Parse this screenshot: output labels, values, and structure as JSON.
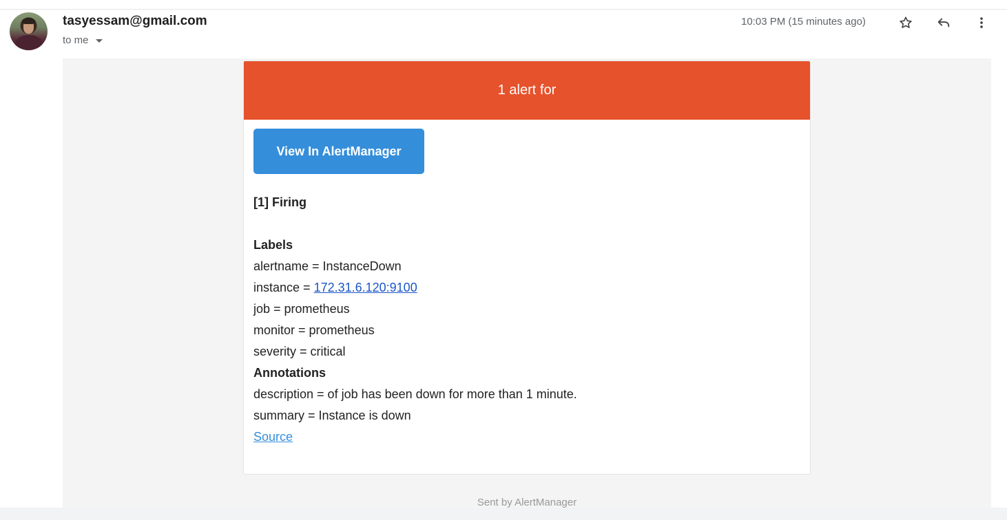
{
  "email": {
    "sender": "tasyessam@gmail.com",
    "recipient_label": "to me",
    "timestamp": "10:03 PM (15 minutes ago)",
    "actions": {
      "star_icon": "star-icon",
      "reply_icon": "reply-icon",
      "more_icon": "more-vert-icon"
    }
  },
  "alert": {
    "header": "1 alert for",
    "header_color": "#e6522c",
    "button_label": "View In AlertManager",
    "button_color": "#348eda",
    "firing_title": "[1] Firing",
    "labels_title": "Labels",
    "labels": {
      "alertname": "alertname = InstanceDown",
      "instance_prefix": "instance = ",
      "instance_link": "172.31.6.120:9100",
      "job": "job = prometheus",
      "monitor": "monitor = prometheus",
      "severity": "severity = critical"
    },
    "annotations_title": "Annotations",
    "annotations": {
      "description": "description = of job has been down for more than 1 minute.",
      "summary": "summary = Instance is down"
    },
    "source_link": "Source",
    "footer": "Sent by AlertManager"
  }
}
